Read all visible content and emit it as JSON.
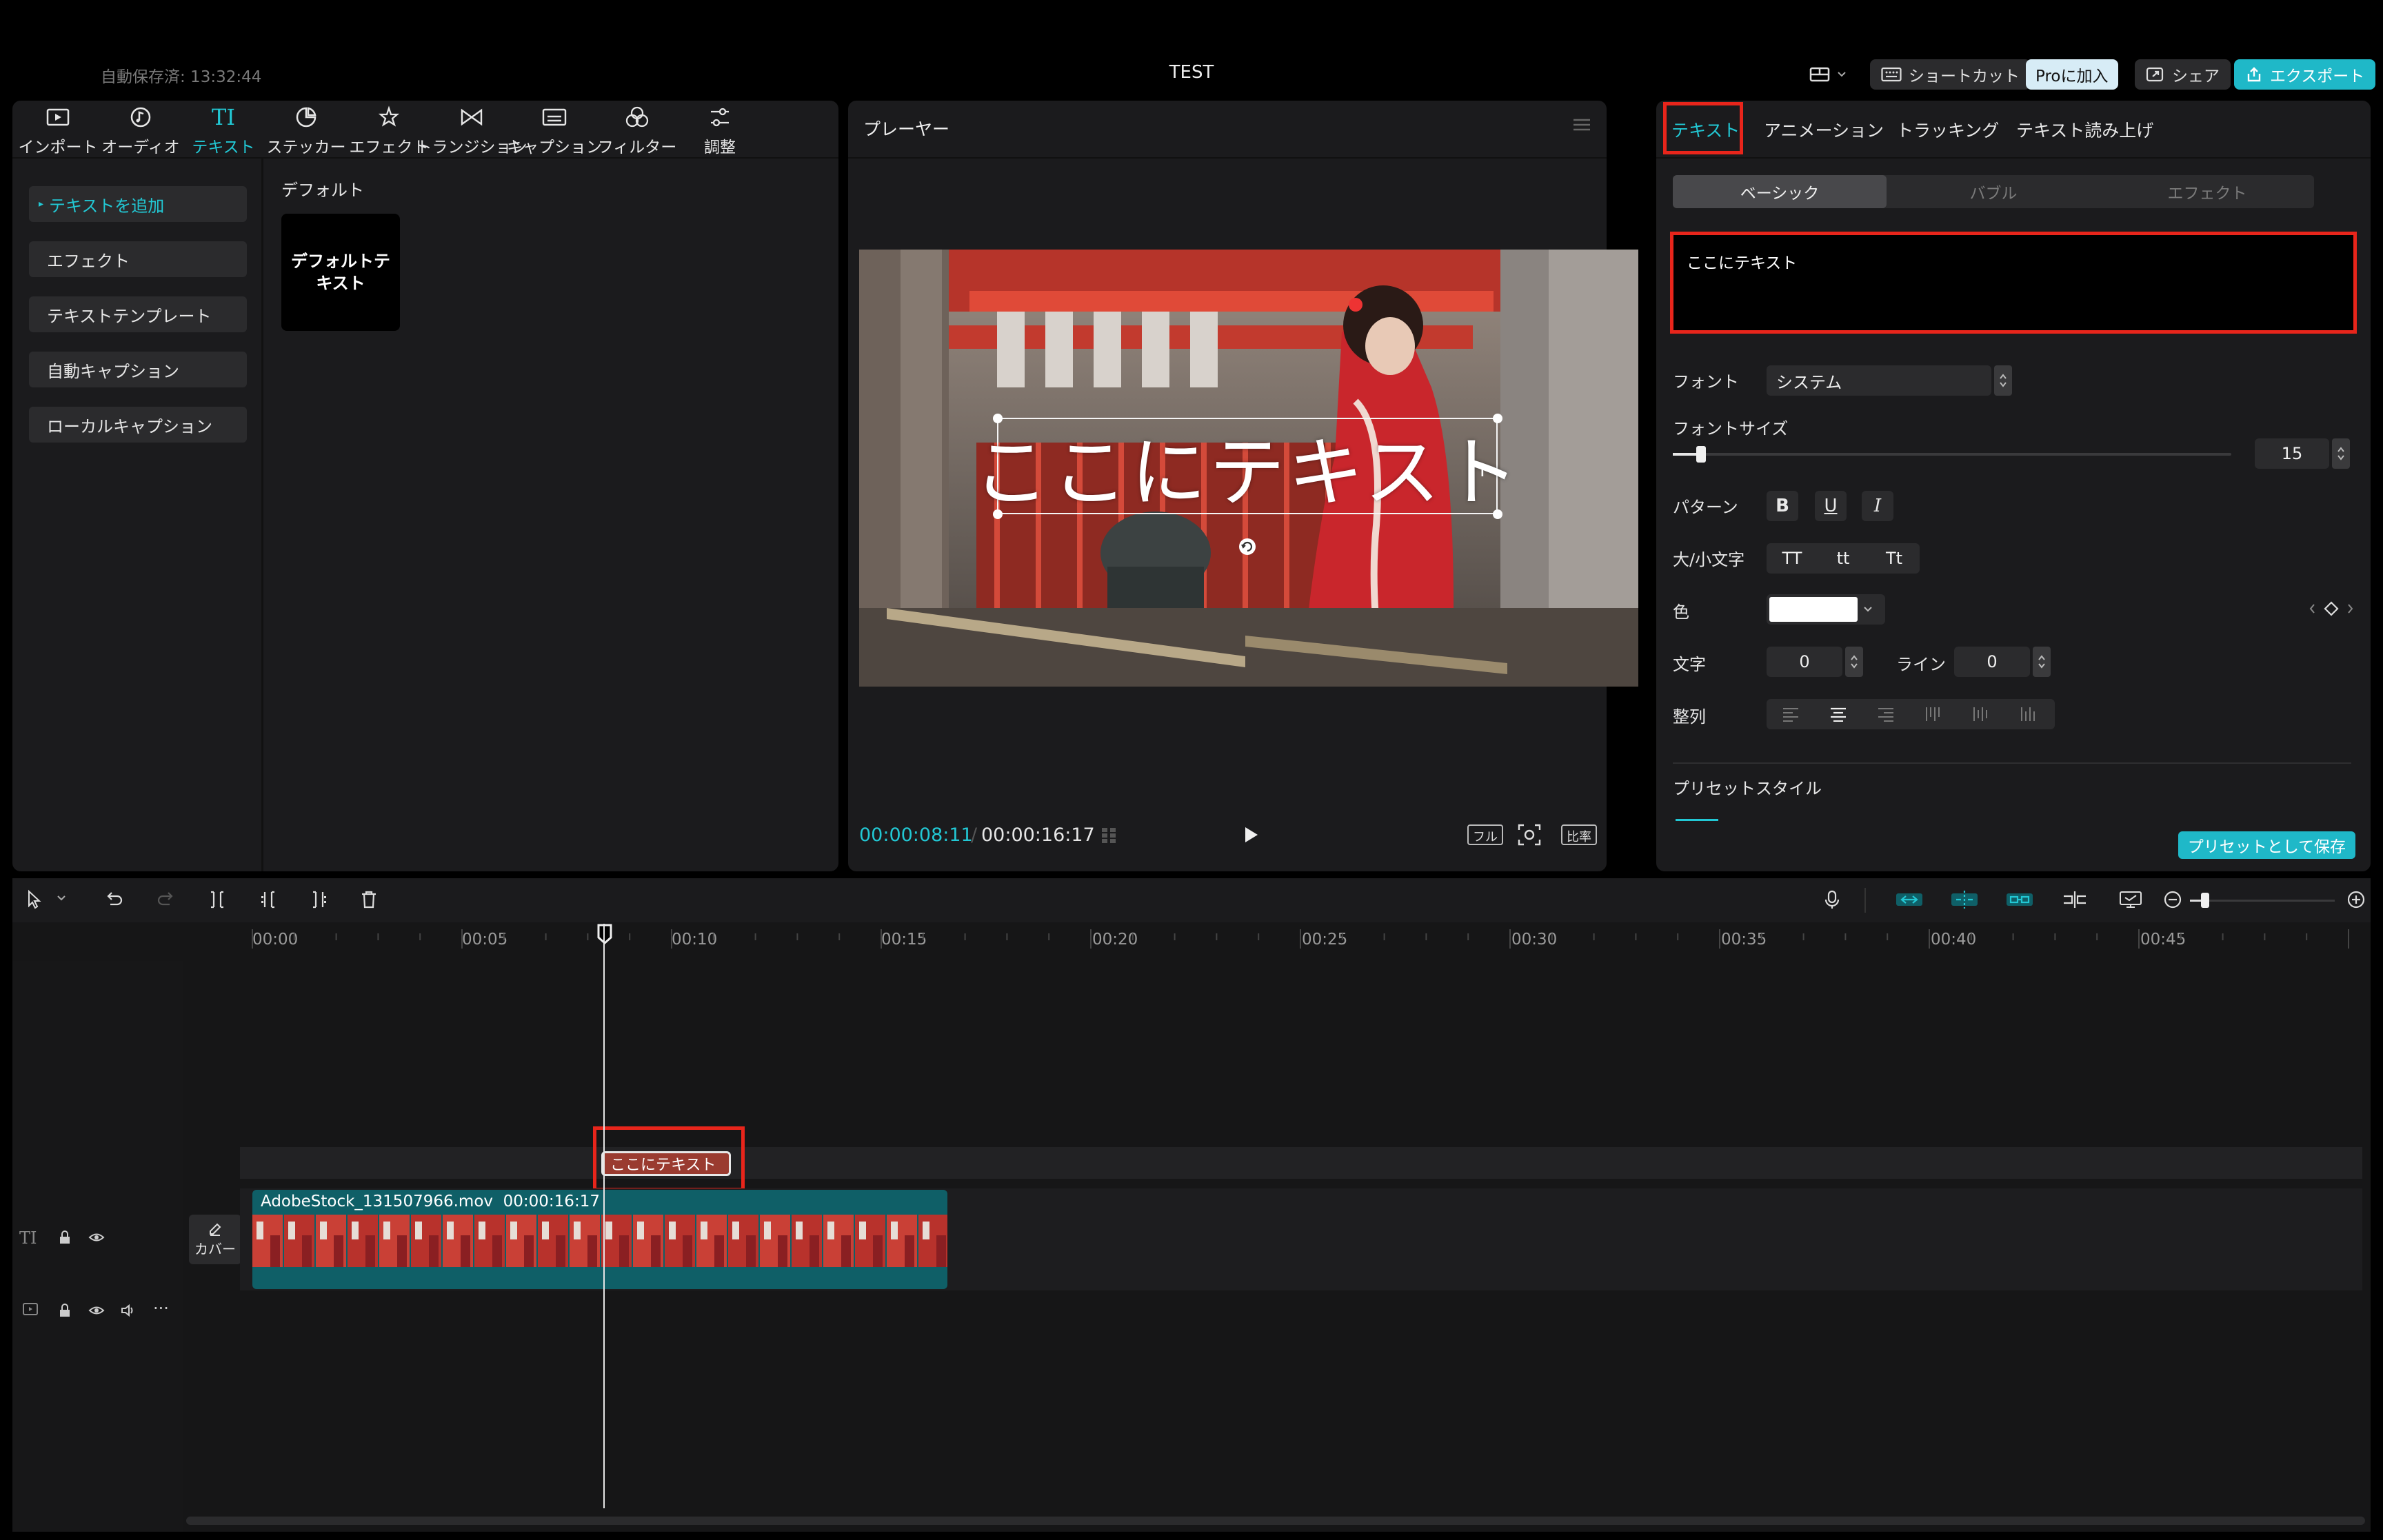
{
  "topbar": {
    "autosave": "自動保存済: 13:32:44",
    "title": "TEST",
    "shortcut": "ショートカット",
    "pro": "Proに加入",
    "share": "シェア",
    "export": "エクスポート"
  },
  "left": {
    "tabs": [
      "インポート",
      "オーディオ",
      "テキスト",
      "ステッカー",
      "エフェクト",
      "トランジション",
      "キャプション",
      "フィルター",
      "調整"
    ],
    "sub": [
      "テキストを追加",
      "エフェクト",
      "テキストテンプレート",
      "自動キャプション",
      "ローカルキャプション"
    ],
    "default_label": "デフォルト",
    "default_card": "デフォルトテキスト"
  },
  "player": {
    "title": "プレーヤー",
    "overlay_text": "ここにテキスト",
    "time_current": "00:00:08:11",
    "time_sep": "/",
    "time_total": "00:00:16:17",
    "btn_full": "フル",
    "btn_ratio": "比率"
  },
  "right": {
    "tabs": [
      "テキスト",
      "アニメーション",
      "トラッキング",
      "テキスト読み上げ"
    ],
    "seg": [
      "ベーシック",
      "バブル",
      "エフェクト"
    ],
    "text_value": "ここにテキスト",
    "font_label": "フォント",
    "font_value": "システム",
    "size_label": "フォントサイズ",
    "size_value": "15",
    "size_fraction": 0.05,
    "pattern_label": "パターン",
    "pattern_buttons": [
      "B",
      "U",
      "I"
    ],
    "case_label": "大/小文字",
    "case_buttons": [
      "TT",
      "tt",
      "Tt"
    ],
    "color_label": "色",
    "color_value": "#ffffff",
    "char_label": "文字",
    "char_value": "0",
    "line_label": "ライン",
    "line_value": "0",
    "align_label": "整列",
    "preset_label": "プリセットスタイル",
    "save_preset": "プリセットとして保存"
  },
  "timeline": {
    "ruler": [
      "00:00",
      "00:05",
      "00:10",
      "00:15",
      "00:20",
      "00:25",
      "00:30",
      "00:35",
      "00:40",
      "00:45"
    ],
    "text_clip": "ここにテキスト",
    "video_clip_name": "AdobeStock_131507966.mov",
    "video_clip_duration": "00:00:16:17",
    "cover": "カバー"
  },
  "colors": {
    "accent": "#22c8d4",
    "highlight": "#e8251b",
    "text_clip": "#9a3b30",
    "video_clip": "#0f5f67"
  }
}
